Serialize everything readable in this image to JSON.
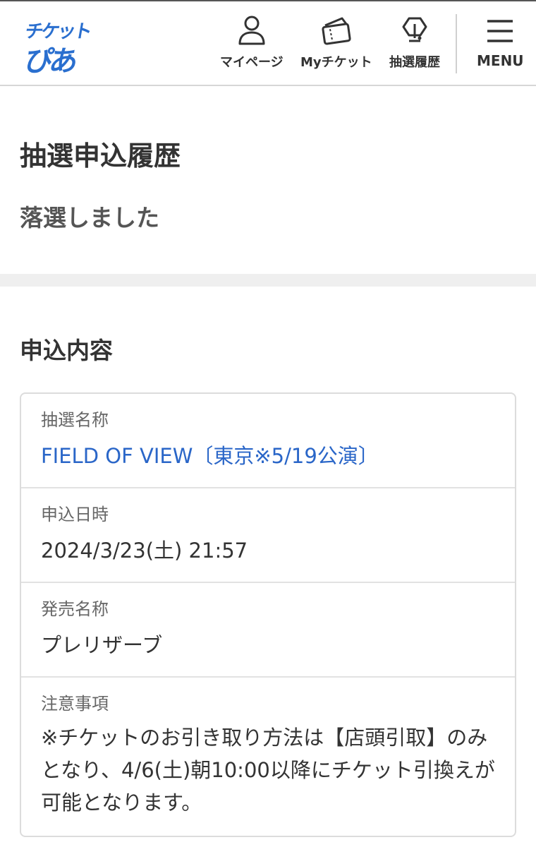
{
  "header": {
    "logo": {
      "top": "チケット",
      "bottom": "ぴあ"
    },
    "nav": [
      {
        "label": "マイページ",
        "icon": "user-icon"
      },
      {
        "label": "Myチケット",
        "icon": "ticket-icon"
      },
      {
        "label": "抽選履歴",
        "icon": "lottery-icon"
      },
      {
        "label": "MENU",
        "icon": "hamburger-menu-icon"
      }
    ]
  },
  "page": {
    "title": "抽選申込履歴",
    "status": "落選しました"
  },
  "details": {
    "section_title": "申込内容",
    "rows": [
      {
        "label": "抽選名称",
        "value": "FIELD OF VIEW〔東京※5/19公演〕"
      },
      {
        "label": "申込日時",
        "value": "2024/3/23(土) 21:57"
      },
      {
        "label": "発売名称",
        "value": "プレリザーブ"
      },
      {
        "label": "注意事項",
        "value": "※チケットのお引き取り方法は【店頭引取】のみとなり、4/6(土)朝10:00以降にチケット引換えが可能となります。"
      }
    ]
  },
  "colors": {
    "brand_blue": "#2a6fcf",
    "link_blue": "#2a66c8",
    "band_gray": "#efefef"
  }
}
